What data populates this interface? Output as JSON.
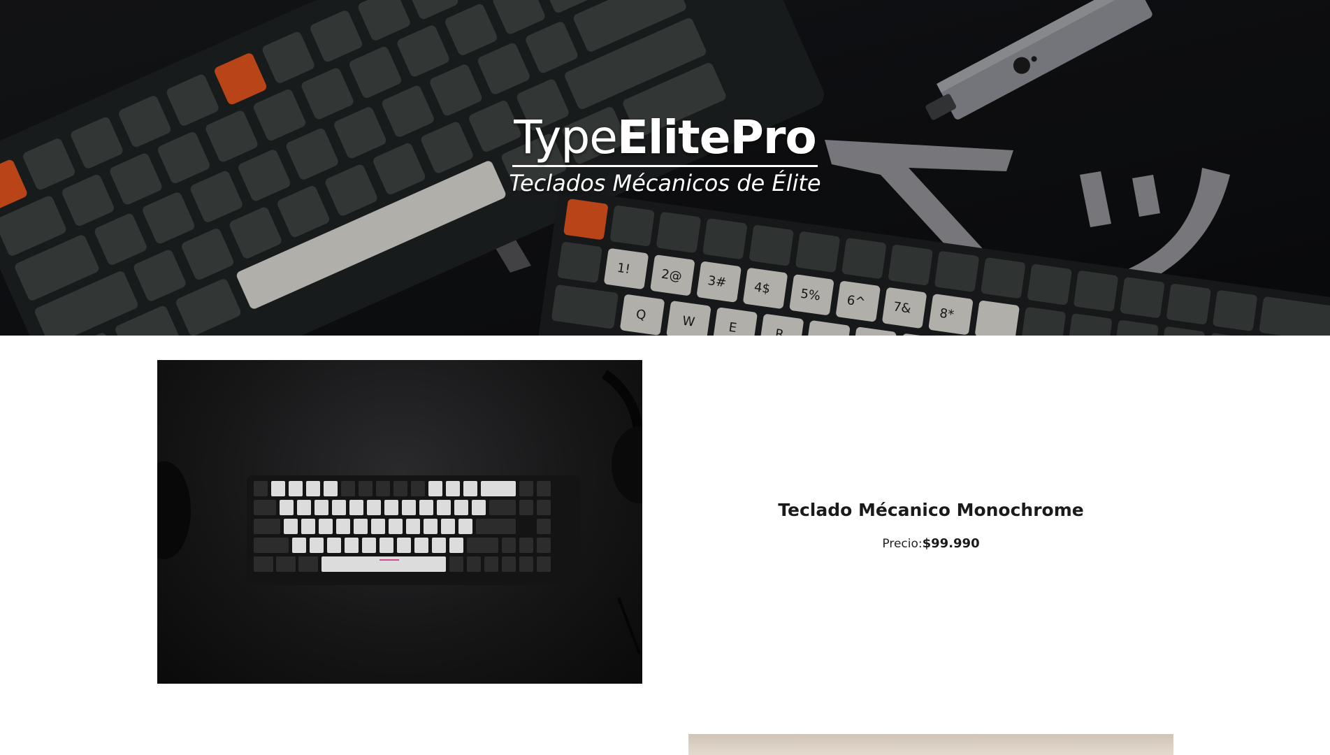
{
  "hero": {
    "brand_light": "Type",
    "brand_bold": "ElitePro",
    "tagline": "Teclados Mécanicos de Élite",
    "background_image": "mechanical-keyboards-banner"
  },
  "products": [
    {
      "name": "Teclado Mécanico Monochrome",
      "price_label": "Precio:",
      "price_value": "$99.990",
      "image": "monochrome-keyboard-photo"
    },
    {
      "image": "wooden-desk-keyboard-photo"
    }
  ],
  "colors": {
    "accent_orange": "#e2541d",
    "key_gray": "#3e4443",
    "key_white": "#d8d6cf",
    "text_dark": "#1a1a1a",
    "background": "#ffffff"
  }
}
